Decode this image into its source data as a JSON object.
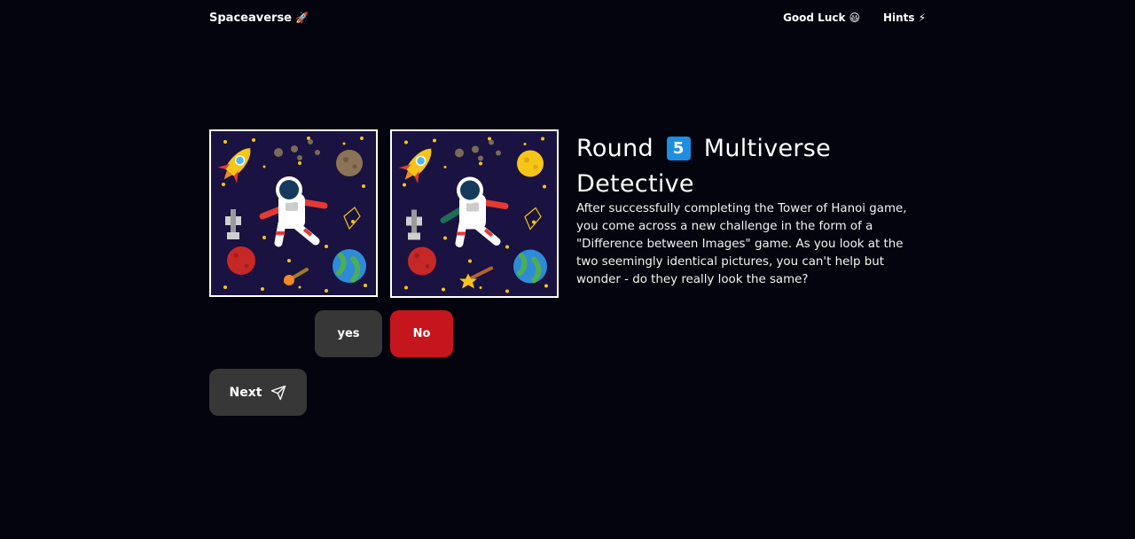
{
  "nav": {
    "brand": "Spaceaverse",
    "brand_icon": "rocket-icon",
    "links": [
      {
        "label": "Good Luck",
        "icon": "grinning-face-icon"
      },
      {
        "label": "Hints",
        "icon": "lightning-icon"
      }
    ]
  },
  "game": {
    "title_prefix": "Round",
    "round_number": "5",
    "title_suffix": "Multiverse Detective",
    "description": "After successfully completing the Tower of Hanoi game, you come across a new challenge in the form of a \"Difference between Images\" game. As you look at the two seemingly identical pictures, you can't help but wonder - do they really look the same?",
    "images": [
      {
        "name": "left-space-image",
        "moon_color": "#8b7355",
        "comet_color": "#f08a24"
      },
      {
        "name": "right-space-image",
        "moon_color": "#f5c518",
        "comet_color": "#f5c518"
      }
    ]
  },
  "buttons": {
    "yes": "yes",
    "no": "No",
    "next": "Next"
  },
  "colors": {
    "background": "#04040e",
    "badge": "#1e8ee0",
    "no_button": "#c4161c",
    "neutral_button": "#373737"
  }
}
